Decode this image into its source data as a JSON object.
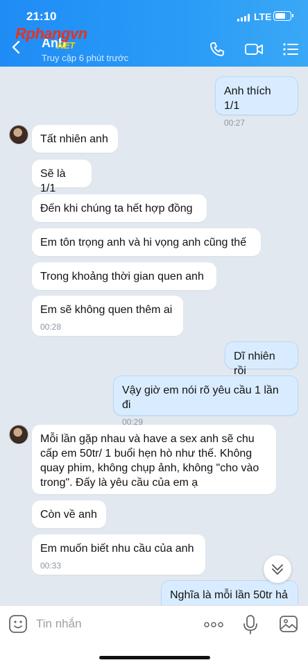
{
  "status": {
    "time": "21:10",
    "network": "LTE"
  },
  "watermark": {
    "text": "Rphangvn",
    "suffix": ".NET"
  },
  "header": {
    "contact_name": "Anh",
    "last_seen": "Truy cập 6 phút trước",
    "icons": [
      "back-arrow-icon",
      "phone-icon",
      "video-call-icon",
      "menu-list-icon"
    ]
  },
  "messages": [
    {
      "dir": "out",
      "text": "Anh thích 1/1",
      "time": "00:27"
    },
    {
      "dir": "in",
      "text": "Tất nhiên anh",
      "time": ""
    },
    {
      "dir": "in",
      "text": "Sẽ là 1/1",
      "time": ""
    },
    {
      "dir": "in",
      "text": "Đến khi chúng ta hết hợp đồng",
      "time": ""
    },
    {
      "dir": "in",
      "text": "Em tôn trọng anh và hi vọng anh cũng thế",
      "time": ""
    },
    {
      "dir": "in",
      "text": "Trong khoảng thời gian quen anh",
      "time": ""
    },
    {
      "dir": "in",
      "text": "Em sẽ không quen thêm ai",
      "time": "00:28"
    },
    {
      "dir": "out",
      "text": "Dĩ nhiên rồi",
      "time": ""
    },
    {
      "dir": "out",
      "text": "Vậy giờ em nói rõ yêu cầu 1 lần đi",
      "time": "00:29"
    },
    {
      "dir": "in",
      "text": "Mỗi lần gặp nhau và have a sex anh sẽ chu cấp em 50tr/ 1 buổi hẹn hò như thế. Không quay phim, không chụp ảnh, không \"cho vào trong\". Đấy là yêu cầu của em ạ",
      "time": ""
    },
    {
      "dir": "in",
      "text": "Còn về anh",
      "time": ""
    },
    {
      "dir": "in",
      "text": "Em muốn biết nhu cầu của anh",
      "time": "00:33"
    },
    {
      "dir": "out",
      "text": "Nghĩa là mỗi lần 50tr hả",
      "time": ""
    }
  ],
  "composer": {
    "placeholder": "Tin nhắn",
    "icons": [
      "emoji-icon",
      "more-options-icon",
      "microphone-icon",
      "image-icon"
    ]
  },
  "colors": {
    "header": "#1f8cf5",
    "chat_bg": "#e2e8ef",
    "out_bubble": "#d9ecff",
    "in_bubble": "#ffffff"
  }
}
